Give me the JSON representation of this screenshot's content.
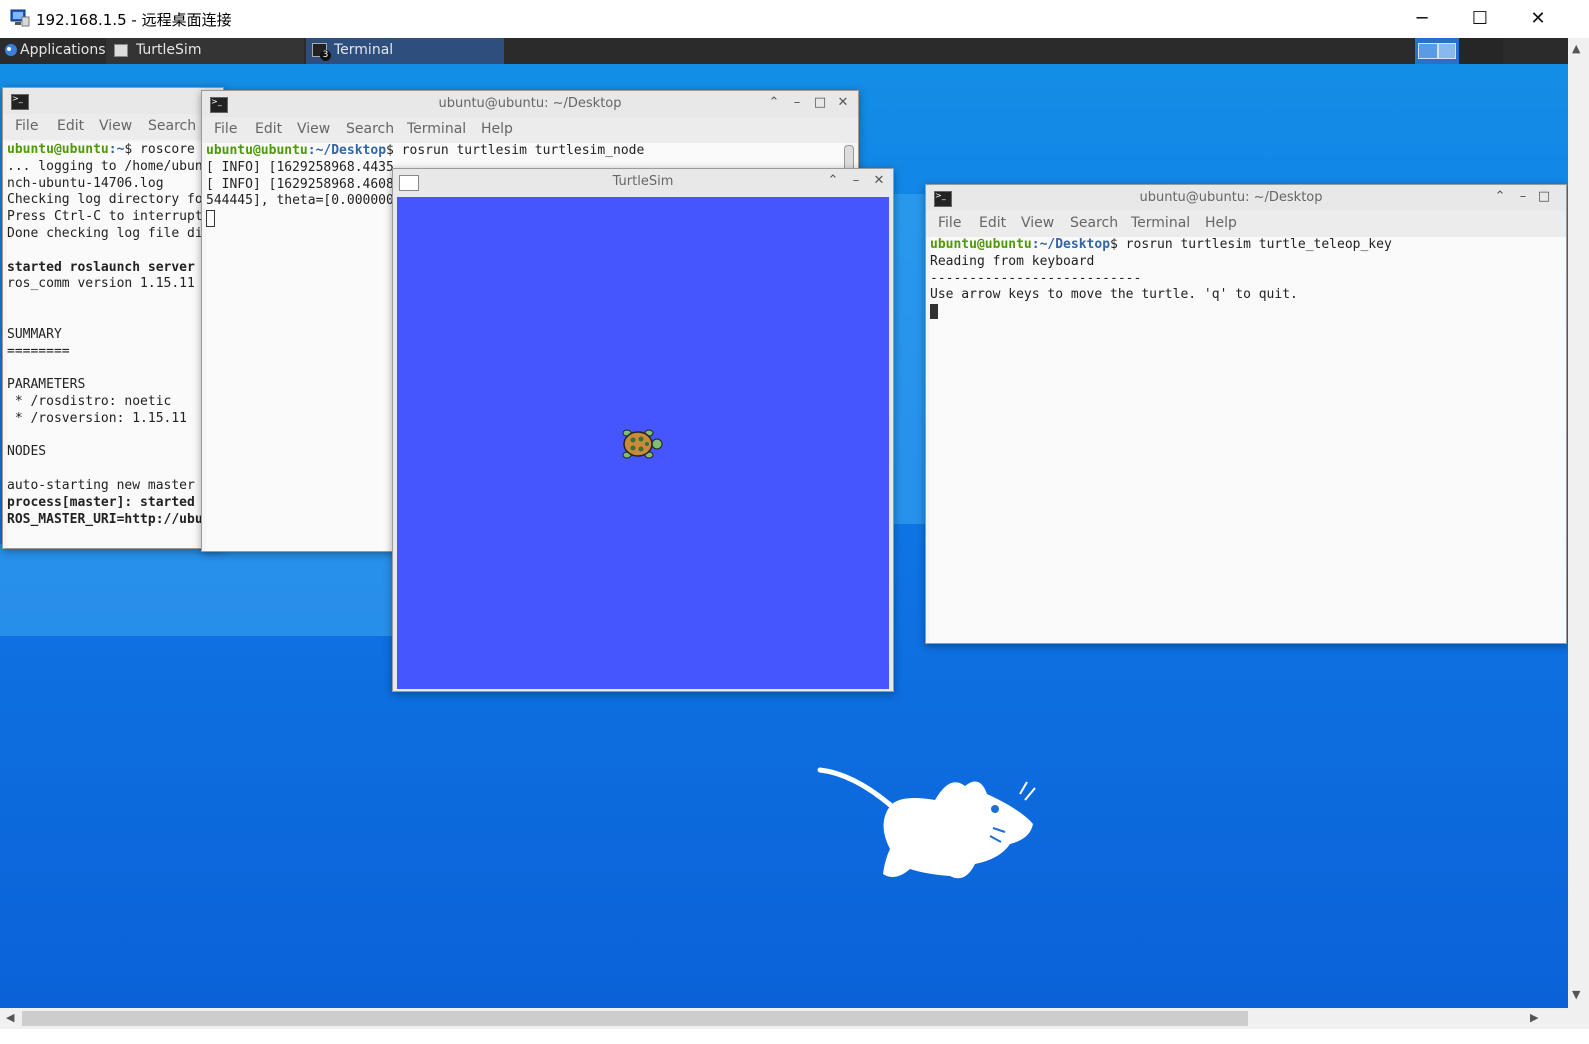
{
  "rdp": {
    "title": "192.168.1.5 - 远程桌面连接",
    "controls": {
      "minimize": "─",
      "maximize": "☐",
      "close": "✕"
    }
  },
  "panel": {
    "applications": "Applications",
    "tasks": [
      {
        "label": "TurtleSim"
      },
      {
        "label": "Terminal",
        "badge": "3"
      }
    ]
  },
  "windows": {
    "roscore": {
      "menu": [
        "File",
        "Edit",
        "View",
        "Search"
      ],
      "lines": [
        {
          "prompt": "ubuntu@ubuntu",
          "path": ":~",
          "cmd": "$ roscore"
        },
        {
          "text": "... logging to /home/ubun"
        },
        {
          "text": "nch-ubuntu-14706.log"
        },
        {
          "text": "Checking log directory fo"
        },
        {
          "text": "Press Ctrl-C to interrupt"
        },
        {
          "text": "Done checking log file di"
        },
        {
          "text": ""
        },
        {
          "text": "started roslaunch server",
          "bold": true
        },
        {
          "text": "ros_comm version 1.15.11"
        },
        {
          "text": ""
        },
        {
          "text": ""
        },
        {
          "text": "SUMMARY"
        },
        {
          "text": "========"
        },
        {
          "text": ""
        },
        {
          "text": "PARAMETERS"
        },
        {
          "text": " * /rosdistro: noetic"
        },
        {
          "text": " * /rosversion: 1.15.11"
        },
        {
          "text": ""
        },
        {
          "text": "NODES"
        },
        {
          "text": ""
        },
        {
          "text": "auto-starting new master"
        },
        {
          "text": "process[master]: started",
          "bold": true
        },
        {
          "text": "ROS_MASTER_URI=http://ubu",
          "bold": true
        }
      ]
    },
    "turtlesim_node": {
      "title": "ubuntu@ubuntu: ~/Desktop",
      "menu": [
        "File",
        "Edit",
        "View",
        "Search",
        "Terminal",
        "Help"
      ],
      "prompt": "ubuntu@ubuntu",
      "path": ":~/Desktop",
      "cmd": "$ rosrun turtlesim turtlesim_node",
      "lines": [
        "[ INFO] [1629258968.4435",
        "[ INFO] [1629258968.4608",
        "544445], theta=[0.000000"
      ]
    },
    "turtlesim": {
      "title": "TurtleSim",
      "canvas_color": "#4556ff"
    },
    "teleop": {
      "title": "ubuntu@ubuntu: ~/Desktop",
      "menu": [
        "File",
        "Edit",
        "View",
        "Search",
        "Terminal",
        "Help"
      ],
      "prompt": "ubuntu@ubuntu",
      "path": ":~/Desktop",
      "cmd": "$ rosrun turtlesim turtle_teleop_key",
      "lines": [
        "Reading from keyboard",
        "---------------------------",
        "Use arrow keys to move the turtle. 'q' to quit."
      ]
    }
  },
  "icons": {
    "rdp": "remote-desktop-icon",
    "terminal": "terminal-icon",
    "turtle": "turtle-icon",
    "mascot": "xfce-mouse-icon"
  }
}
